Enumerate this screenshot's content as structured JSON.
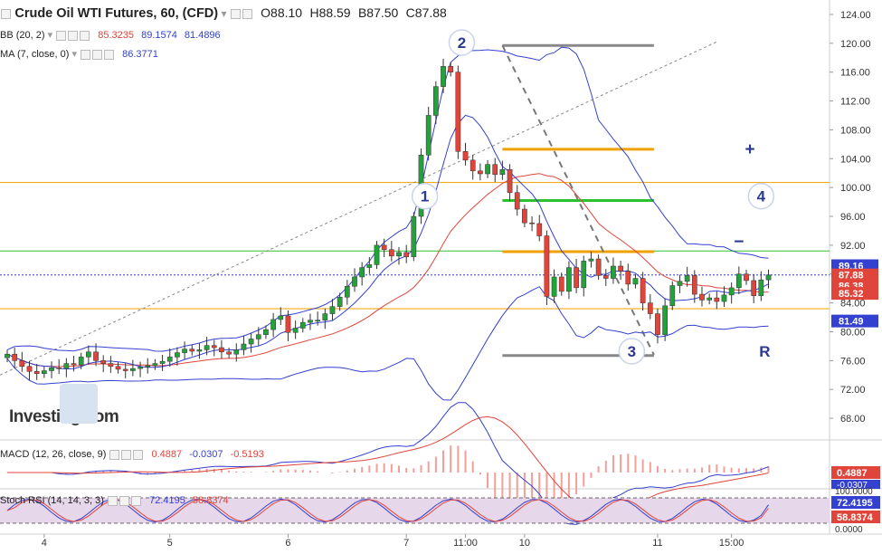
{
  "header": {
    "title": "Crude Oil WTI Futures, 60, (CFD)",
    "ohlc": [
      "O88.10",
      "H88.59",
      "B87.50",
      "C87.88"
    ],
    "bb_label": "BB (20, 2)",
    "bb_values": [
      "85.3235",
      "89.1574",
      "81.4896"
    ],
    "ma_label": "MA (7, close, 0)",
    "ma_value": "86.3771",
    "macd_label": "MACD (12, 26, close, 9)",
    "macd_values": [
      "0.4887",
      "-0.0307",
      "-0.5193"
    ],
    "stoch_label": "Stoch RSI (14, 14, 3, 3)",
    "stoch_values": [
      "72.4195",
      "58.8374"
    ]
  },
  "colors": {
    "up": "#22a33a",
    "down": "#e0453b",
    "bb": "#3440d0",
    "ma": "#e0453b",
    "orange": "#f0a000",
    "green": "#2fc02f",
    "gray": "#888888"
  },
  "logo_text": "Investing.com",
  "chart_data": {
    "type": "candlestick",
    "title": "Crude Oil WTI Futures, 60, (CFD)",
    "y_ticks": [
      124,
      120,
      116,
      112,
      108,
      104,
      100,
      96,
      92,
      88,
      84,
      80,
      76,
      72,
      68
    ],
    "y_range": [
      65,
      126
    ],
    "x_ticks": [
      {
        "label": "4",
        "i": 5
      },
      {
        "label": "5",
        "i": 22
      },
      {
        "label": "6",
        "i": 38
      },
      {
        "label": "7",
        "i": 54
      },
      {
        "label": "11:00",
        "i": 62
      },
      {
        "label": "10",
        "i": 70
      },
      {
        "label": "11",
        "i": 88
      },
      {
        "label": "15:00",
        "i": 98
      }
    ],
    "closes": [
      76.9,
      76,
      75.2,
      74.5,
      74.2,
      74.6,
      75,
      74.9,
      75.6,
      75.4,
      76.5,
      77.2,
      76,
      75.6,
      75.2,
      74.8,
      74.6,
      74.9,
      75.1,
      75.3,
      75.6,
      75.9,
      76.5,
      77.1,
      77.6,
      77.3,
      77.5,
      78.1,
      77.8,
      77.2,
      76.9,
      77.5,
      78.3,
      79,
      79.6,
      80.3,
      81.7,
      82.2,
      79.9,
      80.5,
      81.3,
      81.6,
      81.6,
      82.5,
      83.5,
      84.8,
      86.3,
      87.6,
      88.9,
      89.3,
      92,
      91.4,
      90.5,
      91,
      90.4,
      96,
      104.5,
      110,
      114,
      116.8,
      116,
      105,
      103.8,
      102.3,
      101.9,
      103.2,
      101.8,
      102.5,
      99.3,
      97,
      95.1,
      95,
      93.3,
      84.9,
      87.6,
      85.6,
      88.9,
      86.1,
      89.8,
      90.1,
      87.8,
      87.4,
      89.1,
      88.4,
      86.6,
      87.4,
      84,
      82.5,
      79.6,
      83.6,
      86.4,
      87,
      87.8,
      85.2,
      84.4,
      84.7,
      84.2,
      85.1,
      86.1,
      88,
      87.1,
      85,
      87.2,
      87.88
    ],
    "price_labels": [
      {
        "v": 89.16,
        "text": "89.16",
        "bg": "#3440d0"
      },
      {
        "v": 87.88,
        "text": "87.88",
        "bg": "#e0453b"
      },
      {
        "v": 86.38,
        "text": "86.38",
        "bg": "#e0453b"
      },
      {
        "v": 85.32,
        "text": "85.32",
        "bg": "#e0453b"
      },
      {
        "v": 81.49,
        "text": "81.49",
        "bg": "#3440d0"
      }
    ],
    "hlines": [
      {
        "v": 100.7,
        "color": "#f0a000"
      },
      {
        "v": 91.2,
        "color": "#2fc02f"
      },
      {
        "v": 83.2,
        "color": "#f0a000"
      }
    ],
    "last_price": 87.88,
    "markers": [
      {
        "text": "1",
        "i": 56.5,
        "v": 98.8
      },
      {
        "text": "2",
        "i": 61.5,
        "v": 120.1
      },
      {
        "text": "3",
        "i": 84.5,
        "v": 77.3
      },
      {
        "text": "4",
        "i": 102,
        "v": 98.8
      },
      {
        "text": "R",
        "i": 102.5,
        "v": 77.3
      },
      {
        "text": "+",
        "i": 100.5,
        "v": 105.3
      },
      {
        "text": "−",
        "i": 99,
        "v": 92.5
      }
    ],
    "fib_levels": [
      {
        "v": 119.7,
        "color": "#888888"
      },
      {
        "v": 105.3,
        "color": "#f0a000"
      },
      {
        "v": 98.2,
        "color": "#2fc02f"
      },
      {
        "v": 91.1,
        "color": "#f0a000"
      },
      {
        "v": 76.7,
        "color": "#888888"
      }
    ],
    "macd": {
      "macd": 0.4887,
      "signal": -0.0307,
      "hist": -0.5193
    },
    "stoch": {
      "k": 72.4195,
      "d": 58.8374,
      "levels": [
        "100.0000",
        "0.0000"
      ],
      "k_label": "72.4195",
      "d_label": "58.8374"
    },
    "macd_axis_labels": [
      "0.4887",
      "-0.0307"
    ]
  }
}
